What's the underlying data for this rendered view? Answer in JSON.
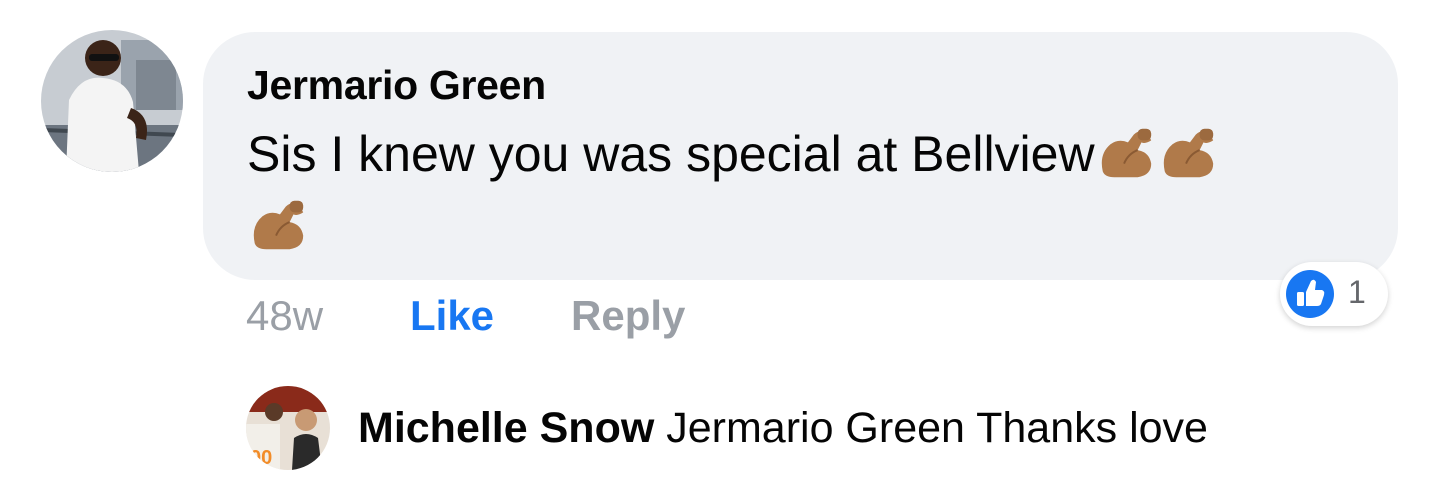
{
  "comment": {
    "author": "Jermario Green",
    "text": "Sis I knew you was special at Bellview",
    "emoji_count": 3,
    "emoji_icon": "flexed-biceps-icon",
    "timestamp": "48w",
    "like_label": "Like",
    "reply_label": "Reply",
    "reaction_icon": "thumbs-up-icon",
    "reaction_count": "1"
  },
  "reply": {
    "author": "Michelle Snow",
    "text": "Jermario Green Thanks love"
  },
  "colors": {
    "bubble": "#f0f2f5",
    "like_blue": "#1877f2",
    "muted": "#9a9fa6",
    "text": "#050505"
  }
}
